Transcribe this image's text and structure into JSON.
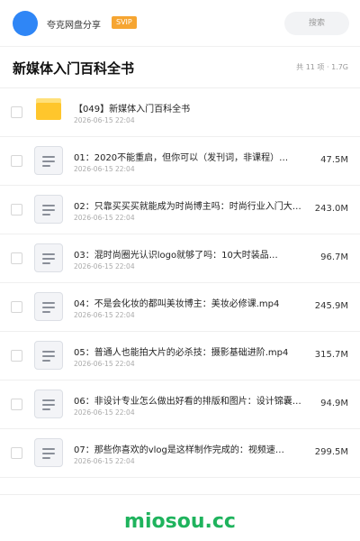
{
  "header": {
    "username": "夸克网盘分享",
    "badge": "SVIP",
    "search_placeholder": "搜索",
    "accent_color": "#2f86f6",
    "badge_color": "#f6a531"
  },
  "title_row": {
    "title": "新媒体入门百科全书",
    "summary": "共 11 项 · 1.7G"
  },
  "files": [
    {
      "type": "folder",
      "icon": "folder-icon",
      "name": "【049】新媒体入门百科全书",
      "date": "2026-06-15 22:04",
      "size": ""
    },
    {
      "type": "file",
      "icon": "document-icon",
      "name": "01：2020不能重启，但你可以（发刊词，非课程）…",
      "date": "2026-06-15 22:04",
      "size": "47.5M"
    },
    {
      "type": "file",
      "icon": "document-icon",
      "name": "02：只靠买买买就能成为时尚博主吗：时尚行业入门大…",
      "date": "2026-06-15 22:04",
      "size": "243.0M"
    },
    {
      "type": "file",
      "icon": "document-icon",
      "name": "03：混时尚圈光认识logo就够了吗：10大时装品…",
      "date": "2026-06-15 22:04",
      "size": "96.7M"
    },
    {
      "type": "file",
      "icon": "document-icon",
      "name": "04：不是会化妆的都叫美妆博主：美妆必修课.mp4",
      "date": "2026-06-15 22:04",
      "size": "245.9M"
    },
    {
      "type": "file",
      "icon": "document-icon",
      "name": "05：普通人也能拍大片的必杀技：摄影基础进阶.mp4",
      "date": "2026-06-15 22:04",
      "size": "315.7M"
    },
    {
      "type": "file",
      "icon": "document-icon",
      "name": "06：非设计专业怎么做出好看的排版和图片：设计锦囊…",
      "date": "2026-06-15 22:04",
      "size": "94.9M"
    },
    {
      "type": "file",
      "icon": "document-icon",
      "name": "07：那些你喜欢的vlog是这样制作完成的：视频速…",
      "date": "2026-06-15 22:04",
      "size": "299.5M"
    }
  ],
  "watermark": "miosou.cc"
}
